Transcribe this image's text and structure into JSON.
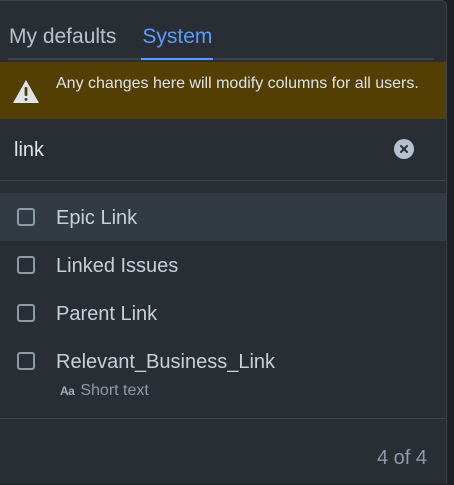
{
  "tabs": [
    {
      "label": "My defaults",
      "active": false
    },
    {
      "label": "System",
      "active": true
    }
  ],
  "warning": {
    "icon": "warning-triangle-icon",
    "text": "Any changes here will modify columns for all users."
  },
  "search": {
    "value": "link",
    "clear_icon": "clear-icon"
  },
  "items": [
    {
      "label": "Epic Link",
      "checked": false
    },
    {
      "label": "Linked Issues",
      "checked": false
    },
    {
      "label": "Parent Link",
      "checked": false
    },
    {
      "label": "Relevant_Business_Link",
      "checked": false,
      "type_icon": "Aa",
      "type": "Short text"
    }
  ],
  "footer": {
    "count": "4 of 4"
  },
  "colors": {
    "accent": "#579dff",
    "warning_bg": "#533f04",
    "panel_bg": "#282e33"
  }
}
